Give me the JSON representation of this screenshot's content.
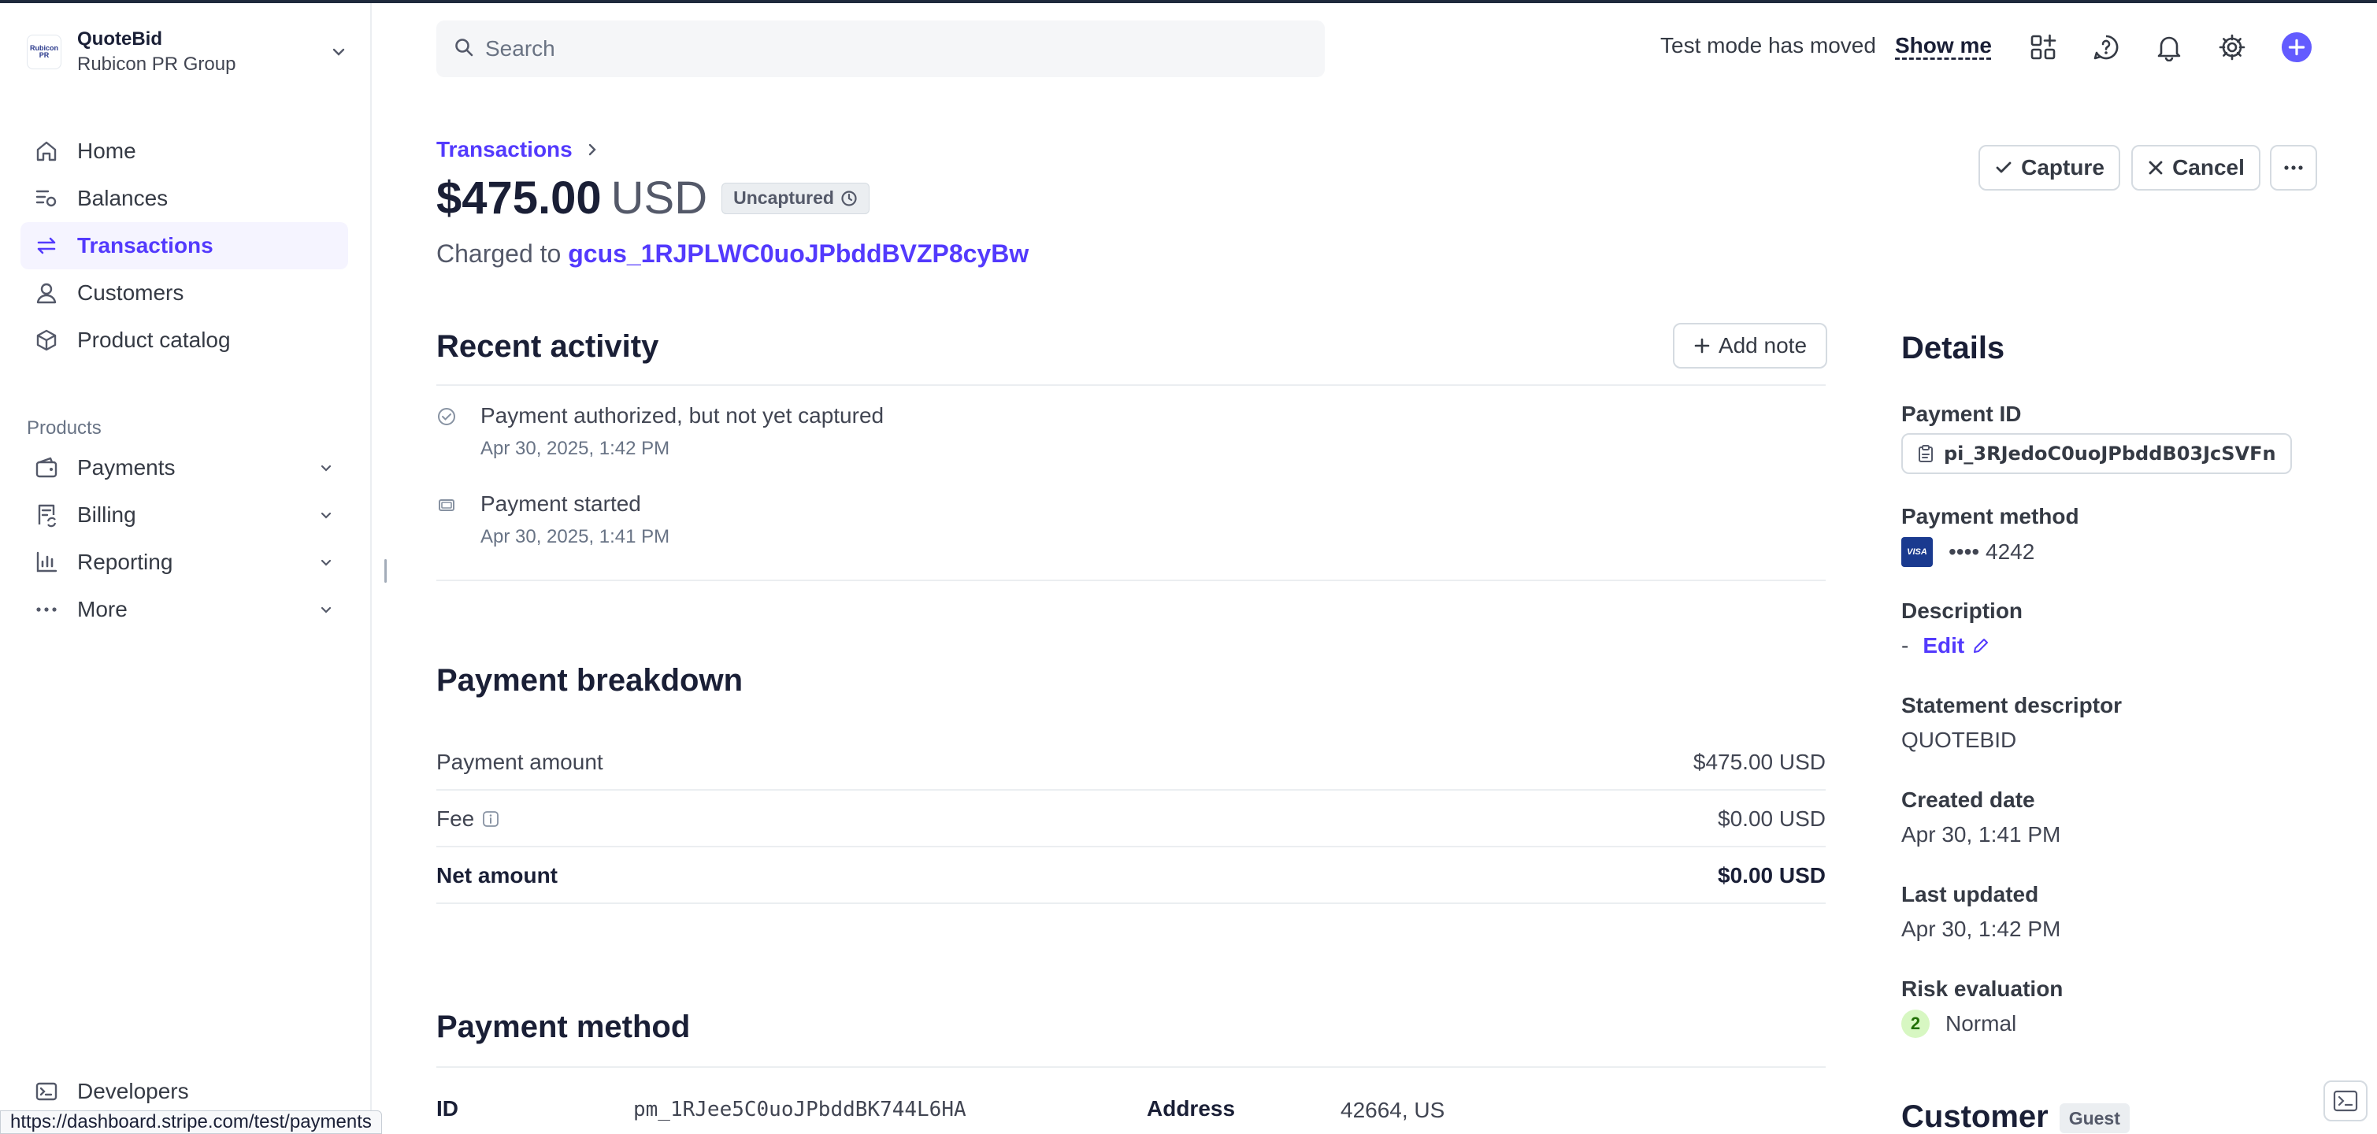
{
  "account": {
    "logo_text": "Rubicon PR",
    "name": "QuoteBid",
    "org": "Rubicon PR Group"
  },
  "sidebar": {
    "items": [
      {
        "label": "Home",
        "icon": "home-icon"
      },
      {
        "label": "Balances",
        "icon": "balances-icon"
      },
      {
        "label": "Transactions",
        "icon": "transactions-icon"
      },
      {
        "label": "Customers",
        "icon": "customers-icon"
      },
      {
        "label": "Product catalog",
        "icon": "product-catalog-icon"
      }
    ],
    "products_title": "Products",
    "products": [
      {
        "label": "Payments",
        "icon": "payments-icon"
      },
      {
        "label": "Billing",
        "icon": "billing-icon"
      },
      {
        "label": "Reporting",
        "icon": "reporting-icon"
      },
      {
        "label": "More",
        "icon": "more-icon"
      }
    ],
    "developers": "Developers"
  },
  "search": {
    "placeholder": "Search"
  },
  "topbar": {
    "test_mode": "Test mode has moved",
    "show_me": "Show me"
  },
  "header": {
    "breadcrumb": "Transactions",
    "amount": "$475.00",
    "currency": "USD",
    "status": "Uncaptured",
    "charged_prefix": "Charged to",
    "customer_id": "gcus_1RJPLWC0uoJPbddBVZP8cyBw",
    "capture_label": "Capture",
    "cancel_label": "Cancel"
  },
  "activity": {
    "title": "Recent activity",
    "add_note": "Add note",
    "events": [
      {
        "title": "Payment authorized, but not yet captured",
        "time": "Apr 30, 2025, 1:42 PM"
      },
      {
        "title": "Payment started",
        "time": "Apr 30, 2025, 1:41 PM"
      }
    ]
  },
  "breakdown": {
    "title": "Payment breakdown",
    "rows": [
      {
        "label": "Payment amount",
        "value": "$475.00 USD"
      },
      {
        "label": "Fee",
        "value": "$0.00 USD"
      },
      {
        "label": "Net amount",
        "value": "$0.00 USD"
      }
    ]
  },
  "payment_method_section": {
    "title": "Payment method",
    "id_label": "ID",
    "id_value": "pm_1RJee5C0uoJPbddBK744L6HA",
    "address_label": "Address",
    "address_value": "42664, US"
  },
  "details": {
    "title": "Details",
    "payment_id_label": "Payment ID",
    "payment_id": "pi_3RJedoC0uoJPbddB03JcSVFn",
    "payment_method_label": "Payment method",
    "card_brand": "VISA",
    "card_last4": "•••• 4242",
    "description_label": "Description",
    "description_value": "-",
    "edit_label": "Edit",
    "statement_label": "Statement descriptor",
    "statement_value": "QUOTEBID",
    "created_label": "Created date",
    "created_value": "Apr 30, 1:41 PM",
    "updated_label": "Last updated",
    "updated_value": "Apr 30, 1:42 PM",
    "risk_label": "Risk evaluation",
    "risk_score": "2",
    "risk_value": "Normal",
    "customer_title": "Customer",
    "customer_badge": "Guest"
  },
  "status_bar": {
    "url": "https://dashboard.stripe.com/test/payments"
  },
  "colors": {
    "accent": "#533afd",
    "text": "#1a1f36",
    "muted": "#687385",
    "border": "#ebeef1"
  }
}
